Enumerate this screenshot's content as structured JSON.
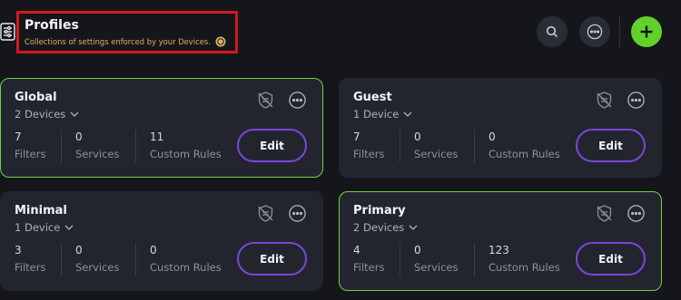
{
  "header": {
    "title": "Profiles",
    "subtitle": "Collections of settings enforced by your Devices.",
    "icons": [
      "sliders-icon",
      "info-coin-icon",
      "search-icon",
      "more-icon",
      "add-icon"
    ]
  },
  "colors": {
    "background": "#15161c",
    "card": "#23252e",
    "active_border": "#6fd23b",
    "accent_purple": "#7a46d9",
    "add_green": "#63d12c",
    "highlight_red": "#d11a1a",
    "subtitle": "#e3b25a"
  },
  "profiles": [
    {
      "name": "Global",
      "devices": "2 Devices",
      "active": true,
      "stats": [
        {
          "value": "7",
          "label": "Filters"
        },
        {
          "value": "0",
          "label": "Services"
        },
        {
          "value": "11",
          "label": "Custom Rules"
        }
      ],
      "edit_label": "Edit"
    },
    {
      "name": "Guest",
      "devices": "1 Device",
      "active": false,
      "stats": [
        {
          "value": "7",
          "label": "Filters"
        },
        {
          "value": "0",
          "label": "Services"
        },
        {
          "value": "0",
          "label": "Custom Rules"
        }
      ],
      "edit_label": "Edit"
    },
    {
      "name": "Minimal",
      "devices": "1 Device",
      "active": false,
      "stats": [
        {
          "value": "3",
          "label": "Filters"
        },
        {
          "value": "0",
          "label": "Services"
        },
        {
          "value": "0",
          "label": "Custom Rules"
        }
      ],
      "edit_label": "Edit"
    },
    {
      "name": "Primary",
      "devices": "2 Devices",
      "active": true,
      "stats": [
        {
          "value": "4",
          "label": "Filters"
        },
        {
          "value": "0",
          "label": "Services"
        },
        {
          "value": "123",
          "label": "Custom Rules"
        }
      ],
      "edit_label": "Edit"
    }
  ]
}
